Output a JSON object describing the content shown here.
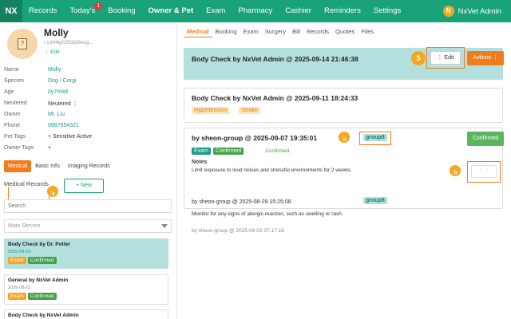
{
  "topbar": {
    "logo": "NX",
    "nav": [
      {
        "label": "Records"
      },
      {
        "label": "Today's",
        "badge": "1"
      },
      {
        "label": "Booking"
      },
      {
        "label": "Owner & Pet"
      },
      {
        "label": "Exam"
      },
      {
        "label": "Pharmacy"
      },
      {
        "label": "Cashier"
      },
      {
        "label": "Reminders"
      },
      {
        "label": "Settings"
      }
    ],
    "user_initial": "N",
    "user_name": "NxVet Admin"
  },
  "pet": {
    "name": "Molly",
    "id": "/ cmf4lp0253j08vug...",
    "edit": "⋮ Edit",
    "fields": [
      {
        "key": "Name",
        "value": "Molly"
      },
      {
        "key": "Species",
        "value": "Dog / Corgi"
      },
      {
        "key": "Age",
        "value": "0y7m8d"
      },
      {
        "key": "Neutered",
        "value": "Neutered ⋮"
      },
      {
        "key": "Owner",
        "value": "Mr. Liu"
      },
      {
        "key": "Phone",
        "value": "0987654321"
      },
      {
        "key": "Pet Tags",
        "value": "+ Sensitive Active"
      },
      {
        "key": "Owner Tags",
        "value": "+"
      }
    ]
  },
  "left_tabs": [
    "Medical",
    "Basic Info",
    "Imaging Records"
  ],
  "medical_records": {
    "title": "Medical Records",
    "new_label": "+ New",
    "search_placeholder": "Search",
    "service_select": "Main Service",
    "items": [
      {
        "title": "Body Check by Dr. Potter",
        "date": "2025-09-19",
        "tags": [
          "Exam",
          "Confirmed"
        ]
      },
      {
        "title": "General by NxVet Admin",
        "date": "2025-08-22",
        "tags": [
          "Exam",
          "Confirmed"
        ]
      },
      {
        "title": "Body Check by NxVet Admin",
        "date": "",
        "tags": []
      }
    ]
  },
  "right_tabs": [
    "Medical",
    "Booking",
    "Exam",
    "Surgery",
    "Bill",
    "Records",
    "Quotes",
    "Files"
  ],
  "entries": {
    "e1": {
      "title": "Body Check by NxVet Admin @ 2025-09-14 21:46:38",
      "edit_label": "⋮ Edit",
      "actions_label": "Actions ⋮",
      "step": "5"
    },
    "e2": {
      "title": "Body Check by NxVet Admin @ 2025-09-11 18:24:33",
      "tags": [
        "Hypertension",
        "Stroke"
      ]
    },
    "e3": {
      "title": "by sheon-group @ 2025-09-07 19:35:01",
      "group": "group8",
      "tags": [
        "Exam",
        "Confirmed"
      ],
      "status_text": "Confirmed",
      "confirmed_label": "Confirmed",
      "notes_label": "Notes",
      "notes": "Limit exposure to loud noises and stressful environments for 2 weeks.",
      "small_btn": "⋮ ⋮"
    },
    "e4": {
      "title": "by sheon-group @ 2025-08-29 15:25:08",
      "group": "group8",
      "text": "Monitor for any signs of allergic reaction, such as swelling or rash."
    },
    "e5": {
      "title": "by sheon-group @ 2025-09-02 07:17:18"
    }
  },
  "markers": {
    "a": "a",
    "b": "b"
  }
}
